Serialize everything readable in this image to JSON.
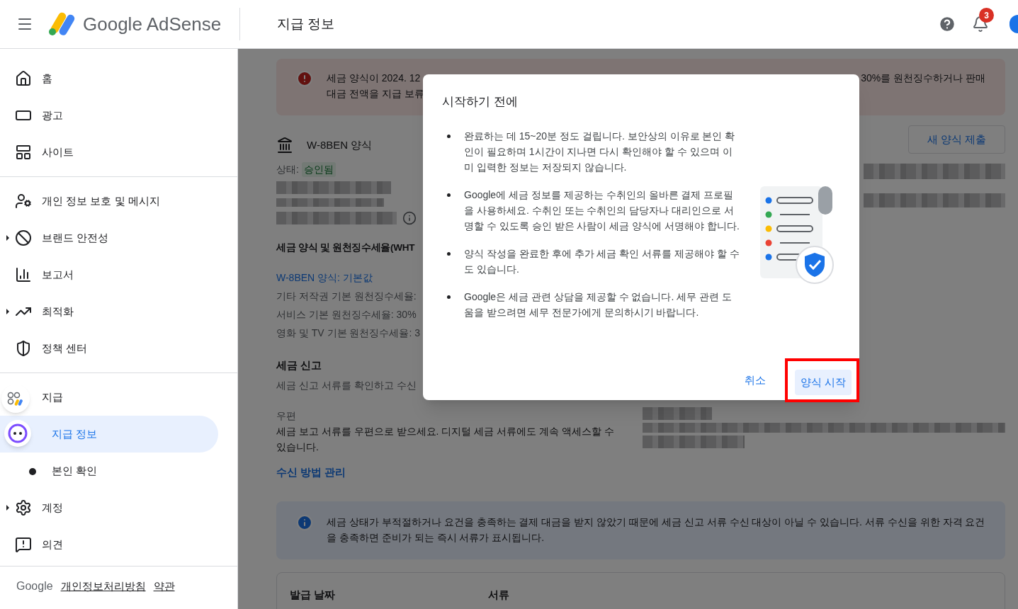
{
  "header": {
    "logo": "Google AdSense",
    "title": "지급 정보",
    "notification_count": "3"
  },
  "sidebar": {
    "sections": [
      [
        {
          "label": "홈",
          "selected": false
        },
        {
          "label": "광고",
          "selected": false
        },
        {
          "label": "사이트",
          "selected": false
        }
      ],
      [
        {
          "label": "개인 정보 보호 및 메시지",
          "selected": false
        },
        {
          "label": "브랜드 안전성",
          "selected": false,
          "expanded": false
        },
        {
          "label": "보고서",
          "selected": false
        },
        {
          "label": "최적화",
          "selected": false,
          "expanded": false
        },
        {
          "label": "정책 센터",
          "selected": false
        }
      ],
      [
        {
          "label": "지급",
          "selected": false,
          "expanded": true,
          "children": [
            {
              "label": "지급 정보",
              "selected": true
            },
            {
              "label": "본인 확인",
              "selected": false
            }
          ]
        },
        {
          "label": "계정",
          "selected": false,
          "expanded": false
        },
        {
          "label": "의견",
          "selected": false
        }
      ]
    ],
    "footer": {
      "brand": "Google",
      "links": [
        "개인정보처리방침",
        "약관"
      ]
    }
  },
  "main": {
    "alert": {
      "left_lines": [
        "세금 양식이 2024. 12",
        "대금 전액을 지급 보류"
      ],
      "right_text": "30%를 원천징수하거나 판매"
    },
    "form": {
      "title": "W-8BEN 양식",
      "button": "새 양식 제출",
      "status_label": "상태:",
      "status": "승인됨"
    },
    "withholding": {
      "title": "세금 양식 및 원천징수세율(WHT",
      "link": "W-8BEN 양식: 기본값",
      "lines": [
        "기타 저작권 기본 원천징수세율:",
        "서비스 기본 원천징수세율: 30%",
        "영화 및 TV 기본 원천징수세율: 3"
      ]
    },
    "tax_filing": {
      "title": "세금 신고",
      "description": "세금 신고 서류를 확인하고 수신"
    },
    "mail": {
      "label": "우편",
      "description": "세금 보고 서류를 우편으로 받으세요. 디지털 세금 서류에도 계속 액세스할 수 있습니다.",
      "link": "수신 방법 관리"
    },
    "info": "세금 상태가 부적절하거나 요건을 충족하는 결제 대금을 받지 않았기 때문에 세금 신고 서류 수신 대상이 아닐 수 있습니다. 서류 수신을 위한 자격 요건을 충족하면 준비가 되는 즉시 서류가 표시됩니다.",
    "table": {
      "columns": [
        "발급 날짜",
        "서류"
      ]
    }
  },
  "dialog": {
    "title": "시작하기 전에",
    "bullets": [
      "완료하는 데 15~20분 정도 걸립니다. 보안상의 이유로 본인 확인이 필요하며 1시간이 지나면 다시 확인해야 할 수 있으며 이미 입력한 정보는 저장되지 않습니다.",
      "Google에 세금 정보를 제공하는 수취인의 올바른 결제 프로필을 사용하세요. 수취인 또는 수취인의 담당자나 대리인으로 서명할 수 있도록 승인 받은 사람이 세금 양식에 서명해야 합니다.",
      "양식 작성을 완료한 후에 추가 세금 확인 서류를 제공해야 할 수도 있습니다.",
      "Google은 세금 관련 상담을 제공할 수 없습니다. 세무 관련 도움을 받으려면 세무 전문가에게 문의하시기 바랍니다."
    ],
    "cancel": "취소",
    "start": "양식 시작",
    "start_highlighted": true
  }
}
